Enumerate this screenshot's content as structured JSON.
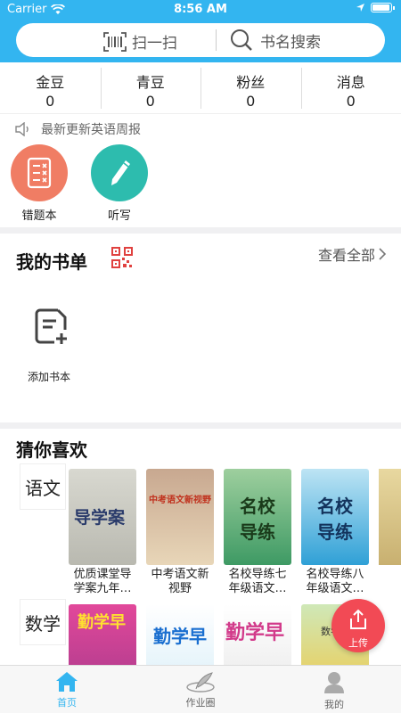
{
  "status": {
    "carrier": "Carrier",
    "time": "8:56 AM"
  },
  "search": {
    "scan_label": "扫一扫",
    "search_label": "书名搜索"
  },
  "stats": [
    {
      "label": "金豆",
      "value": "0"
    },
    {
      "label": "青豆",
      "value": "0"
    },
    {
      "label": "粉丝",
      "value": "0"
    },
    {
      "label": "消息",
      "value": "0"
    }
  ],
  "notice": {
    "text": "最新更新英语周报"
  },
  "tools": [
    {
      "label": "错题本",
      "color": "#f07d64"
    },
    {
      "label": "听写",
      "color": "#2dbcae"
    }
  ],
  "booklist": {
    "title": "我的书单",
    "see_all": "查看全部",
    "add_label": "添加书本"
  },
  "recommend": {
    "title": "猜你喜欢",
    "categories": [
      {
        "name": "语文",
        "books": [
          {
            "title": "优质课堂导学案九年…",
            "cover_text": "导学案"
          },
          {
            "title": "中考语文新视野",
            "cover_text": "中考语文新视野"
          },
          {
            "title": "名校导练七年级语文…",
            "cover_text": "名校导练"
          },
          {
            "title": "名校导练八年级语文…",
            "cover_text": "名校导练"
          }
        ]
      },
      {
        "name": "数学",
        "books": [
          {
            "title": "",
            "cover_text": "勤学早"
          },
          {
            "title": "",
            "cover_text": "勤学早"
          },
          {
            "title": "",
            "cover_text": "勤学早"
          },
          {
            "title": "",
            "cover_text": "数学"
          }
        ]
      }
    ]
  },
  "upload": {
    "label": "上传"
  },
  "tabs": [
    {
      "label": "首页",
      "active": true
    },
    {
      "label": "作业圈",
      "active": false
    },
    {
      "label": "我的",
      "active": false
    }
  ],
  "colors": {
    "brand": "#33b5f0",
    "upload": "#f24a55",
    "qr": "#e0413f"
  }
}
